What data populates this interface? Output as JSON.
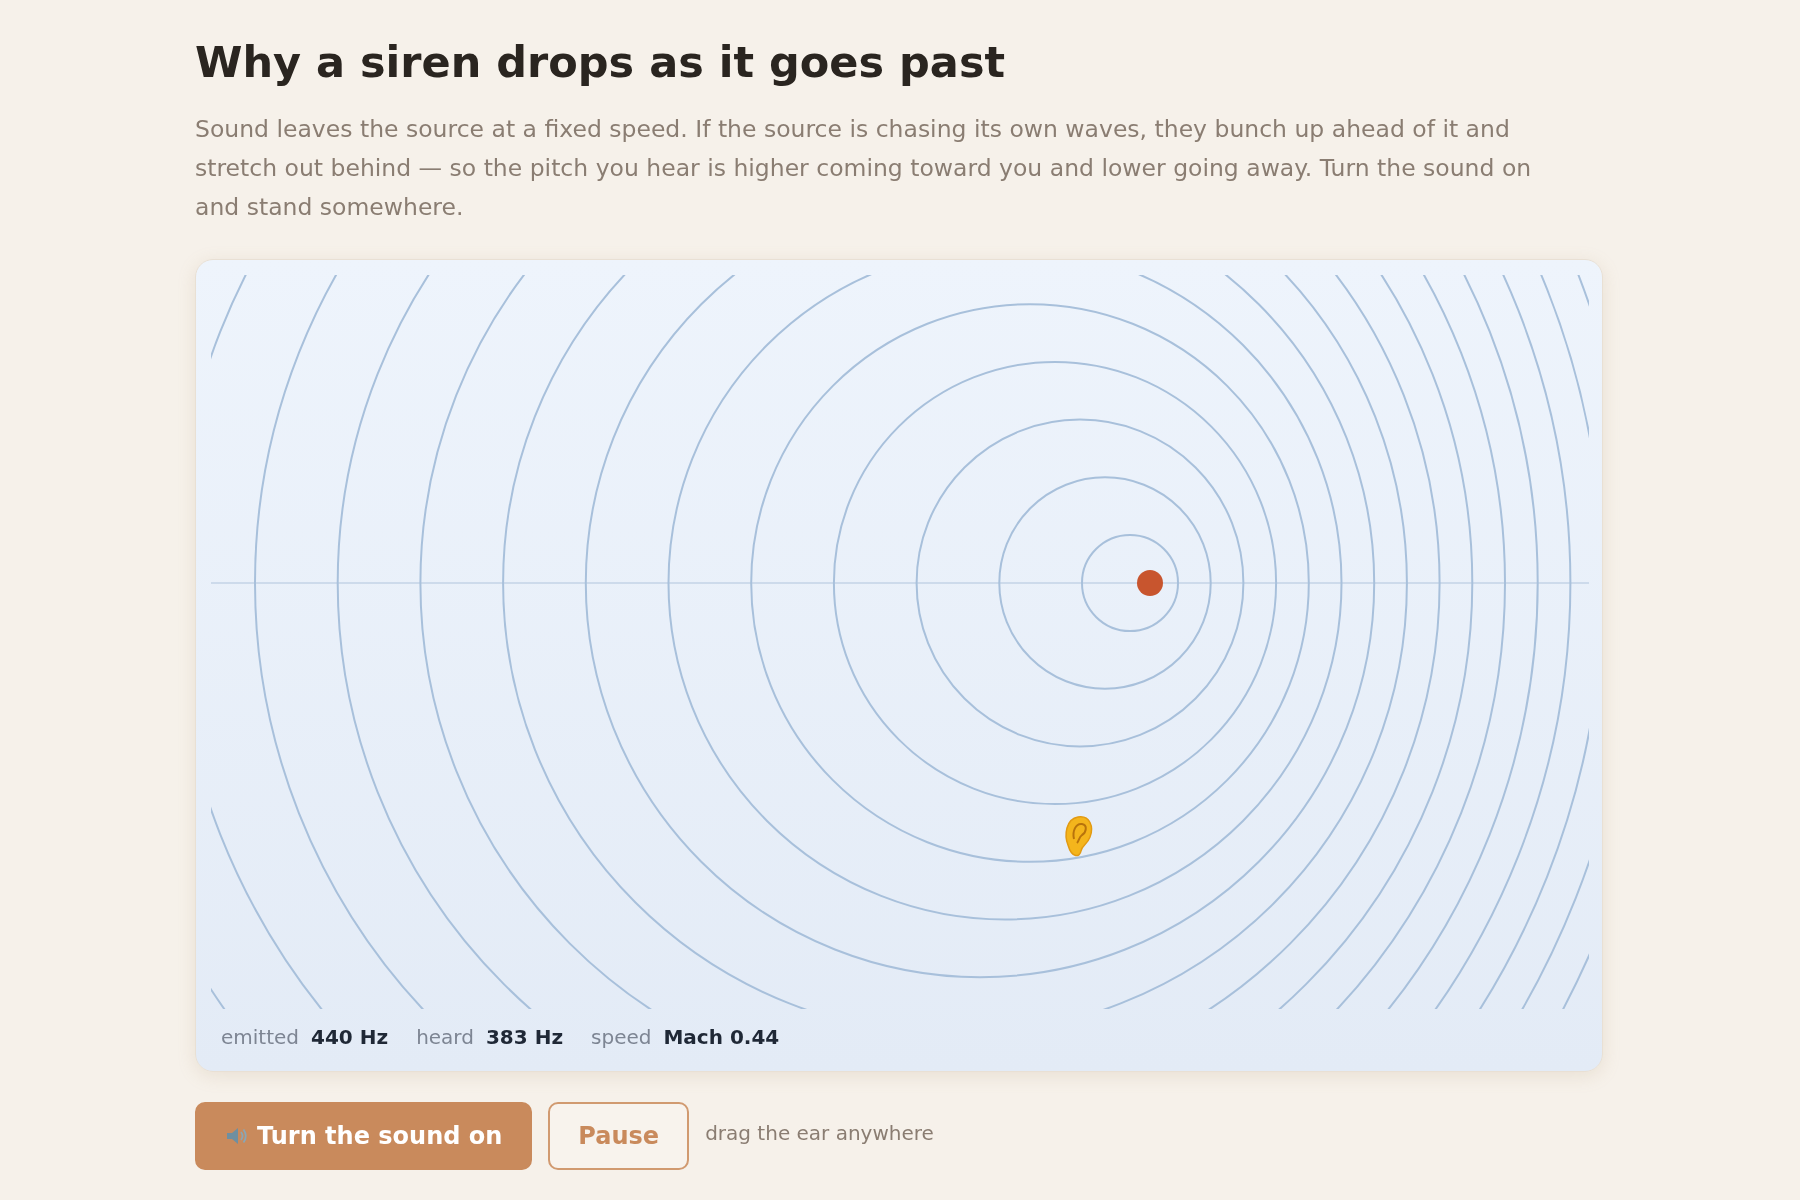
{
  "title": "Why a siren drops as it goes past",
  "intro": "Sound leaves the source at a fixed speed. If the source is chasing its own waves, they bunch up ahead of it and stretch out behind — so the pitch you hear is higher coming toward you and lower going away. Turn the sound on and stand somewhere.",
  "readouts": [
    {
      "label": "emitted",
      "value": "440 Hz"
    },
    {
      "label": "heard",
      "value": "383 Hz"
    },
    {
      "label": "speed",
      "value": "Mach 0.44"
    }
  ],
  "buttons": [
    {
      "label": "Turn the sound on",
      "kind": "primary"
    },
    {
      "label": "Pause",
      "kind": "outline"
    }
  ],
  "hint": "drag the ear anywhere"
}
